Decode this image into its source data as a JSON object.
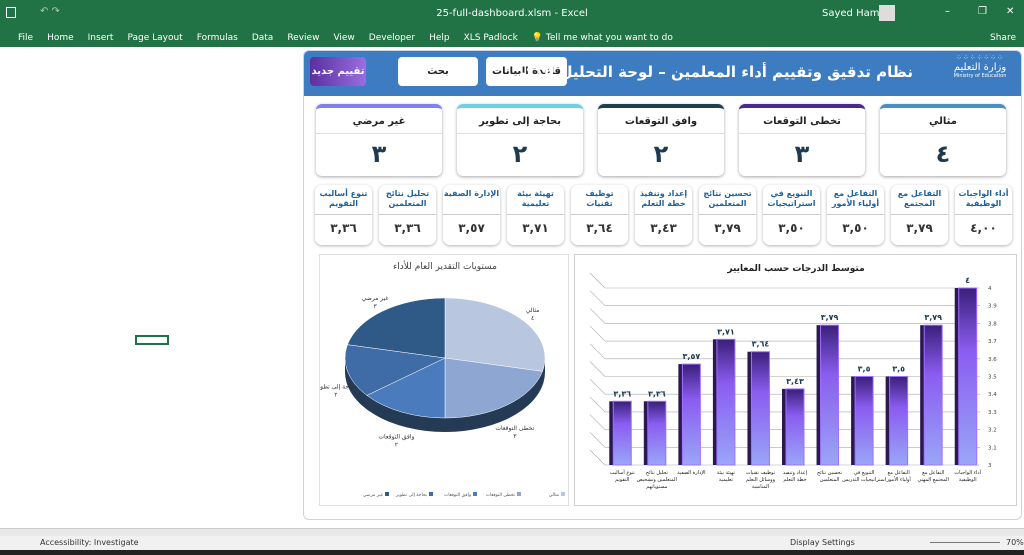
{
  "window": {
    "title": "25-full-dashboard.xlsm  -  Excel",
    "user": "Sayed Hamdy"
  },
  "ribbon": {
    "tabs": [
      "File",
      "Home",
      "Insert",
      "Page Layout",
      "Formulas",
      "Data",
      "Review",
      "View",
      "Developer",
      "Help",
      "XLS Padlock"
    ],
    "tell_me": "Tell me what you want to do",
    "share": "Share"
  },
  "header": {
    "title": "نظام تدقيق وتقييم أداء المعلمين – لوحة التحليل الذكي",
    "new_eval": "تقييم جديد",
    "search": "بحث",
    "database": "قاعدة البيانات",
    "logo_ar": "وزارة التعليم",
    "logo_en": "Ministry of Education"
  },
  "kpis": [
    {
      "label": "مثالي",
      "value": "٤",
      "color": "#4a8fc0"
    },
    {
      "label": "تخطى التوقعات",
      "value": "٣",
      "color": "#4b2a8a"
    },
    {
      "label": "وافق التوقعات",
      "value": "٢",
      "color": "#1f3f4f"
    },
    {
      "label": "بحاجة إلى تطوير",
      "value": "٢",
      "color": "#6fd0e0"
    },
    {
      "label": "غير مرضي",
      "value": "٣",
      "color": "#8080f0"
    }
  ],
  "criteria": [
    {
      "label": "أداء الواجبات الوظيفية",
      "value": "٤,٠٠"
    },
    {
      "label": "التفاعل مع المجتمع",
      "value": "٣,٧٩"
    },
    {
      "label": "التفاعل مع أولياء الأمور",
      "value": "٣,٥٠"
    },
    {
      "label": "التنويع في استراتيجيات",
      "value": "٣,٥٠"
    },
    {
      "label": "تحسين نتائج المتعلمين",
      "value": "٣,٧٩"
    },
    {
      "label": "إعداد وتنفيذ خطة التعلم",
      "value": "٣,٤٣"
    },
    {
      "label": "توظيف تقنيات",
      "value": "٣,٦٤"
    },
    {
      "label": "تهيئة بيئة تعليمية",
      "value": "٣,٧١"
    },
    {
      "label": "الإدارة الصفية",
      "value": "٣,٥٧"
    },
    {
      "label": "تحليل نتائج المتعلمين",
      "value": "٣,٣٦"
    },
    {
      "label": "تنوع أساليب التقويم",
      "value": "٣,٣٦"
    }
  ],
  "chart_data": [
    {
      "type": "pie",
      "title": "مستويات التقدير العام للأداء",
      "labels": [
        "مثالي",
        "تخطى التوقعات",
        "وافق التوقعات",
        "بحاجة إلى تطوير",
        "غير مرضي"
      ],
      "values": [
        4,
        3,
        2,
        2,
        3
      ],
      "value_labels": [
        "٤",
        "٣",
        "٢",
        "٢",
        "٣"
      ],
      "colors": [
        "#b8c6e0",
        "#8ea6d2",
        "#4a7bbd",
        "#3f6ca6",
        "#2f5a88"
      ],
      "legend": "bottom"
    },
    {
      "type": "bar",
      "title": "متوسط الدرجات حسب المعايير",
      "categories": [
        "تنوع أساليب التقويم",
        "تحليل نتائج المتعلمين وتشخيص مستوياتهم",
        "الإدارة الصفية",
        "تهيئة بيئة تعليمية",
        "توظيف تقنيات ووسائل التعلم المناسبة",
        "إعداد وتنفيذ خطة التعلم",
        "تحسين نتائج المتعلمين",
        "التنويع في استراتيجيات التدريس",
        "التفاعل مع أولياء الأمور",
        "التفاعل مع المجتمع المهني",
        "أداء الواجبات الوظيفية"
      ],
      "values": [
        3.36,
        3.36,
        3.57,
        3.71,
        3.64,
        3.43,
        3.79,
        3.5,
        3.5,
        3.79,
        4
      ],
      "data_labels": [
        "٣,٣٦",
        "٣,٣٦",
        "٣,٥٧",
        "٣,٧١",
        "٣,٦٤",
        "٣,٤٣",
        "٣,٧٩",
        "٣,٥",
        "٣,٥",
        "٣,٧٩",
        "٤"
      ],
      "ylim": [
        3,
        4
      ],
      "yticks": [
        "3",
        "3.1",
        "3.2",
        "3.3",
        "3.4",
        "3.5",
        "3.6",
        "3.7",
        "3.8",
        "3.9",
        "4"
      ],
      "grid": true
    }
  ],
  "status": {
    "accessibility": "Accessibility: Investigate",
    "display": "Display Settings",
    "zoom": "70%"
  }
}
